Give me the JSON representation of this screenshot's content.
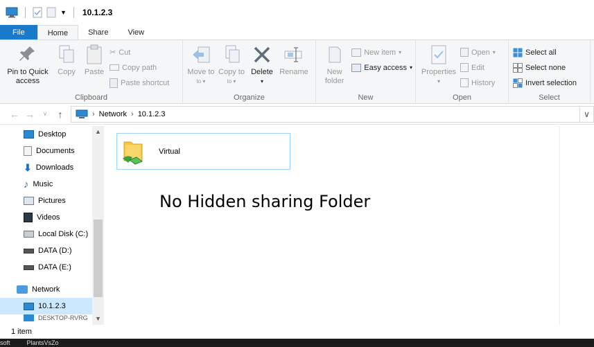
{
  "window": {
    "title": "10.1.2.3"
  },
  "tabs": [
    {
      "label": "File"
    },
    {
      "label": "Home"
    },
    {
      "label": "Share"
    },
    {
      "label": "View"
    }
  ],
  "ribbon": {
    "clipboard": {
      "label": "Clipboard",
      "pin": "Pin to Quick access",
      "copy": "Copy",
      "paste": "Paste",
      "cut": "Cut",
      "copy_path": "Copy path",
      "paste_shortcut": "Paste shortcut"
    },
    "organize": {
      "label": "Organize",
      "move_to": "Move to",
      "copy_to": "Copy to",
      "delete": "Delete",
      "rename": "Rename"
    },
    "new": {
      "label": "New",
      "new_folder": "New folder",
      "new_item": "New item",
      "easy_access": "Easy access"
    },
    "open": {
      "label": "Open",
      "properties": "Properties",
      "open": "Open",
      "edit": "Edit",
      "history": "History"
    },
    "select": {
      "label": "Select",
      "select_all": "Select all",
      "select_none": "Select none",
      "invert": "Invert selection"
    }
  },
  "address": {
    "crumbs": [
      "Network",
      "10.1.2.3"
    ]
  },
  "nav": {
    "items": [
      {
        "label": "Desktop",
        "icon": "desktop-icon"
      },
      {
        "label": "Documents",
        "icon": "documents-icon"
      },
      {
        "label": "Downloads",
        "icon": "downloads-icon"
      },
      {
        "label": "Music",
        "icon": "music-icon"
      },
      {
        "label": "Pictures",
        "icon": "pictures-icon"
      },
      {
        "label": "Videos",
        "icon": "videos-icon"
      },
      {
        "label": "Local Disk (C:)",
        "icon": "drive-icon"
      },
      {
        "label": "DATA (D:)",
        "icon": "drive-icon"
      },
      {
        "label": "DATA (E:)",
        "icon": "drive-icon"
      }
    ],
    "network": "Network",
    "selected": "10.1.2.3",
    "partial": "DESKTOP-RVRG"
  },
  "main": {
    "folder": "Virtual",
    "note": "No Hidden sharing Folder"
  },
  "status": {
    "count": "1 item"
  },
  "taskbar": {
    "items": [
      "soft",
      "PlantsVsZo"
    ]
  },
  "colors": {
    "accent": "#1979ca",
    "selected": "#cce8ff"
  }
}
